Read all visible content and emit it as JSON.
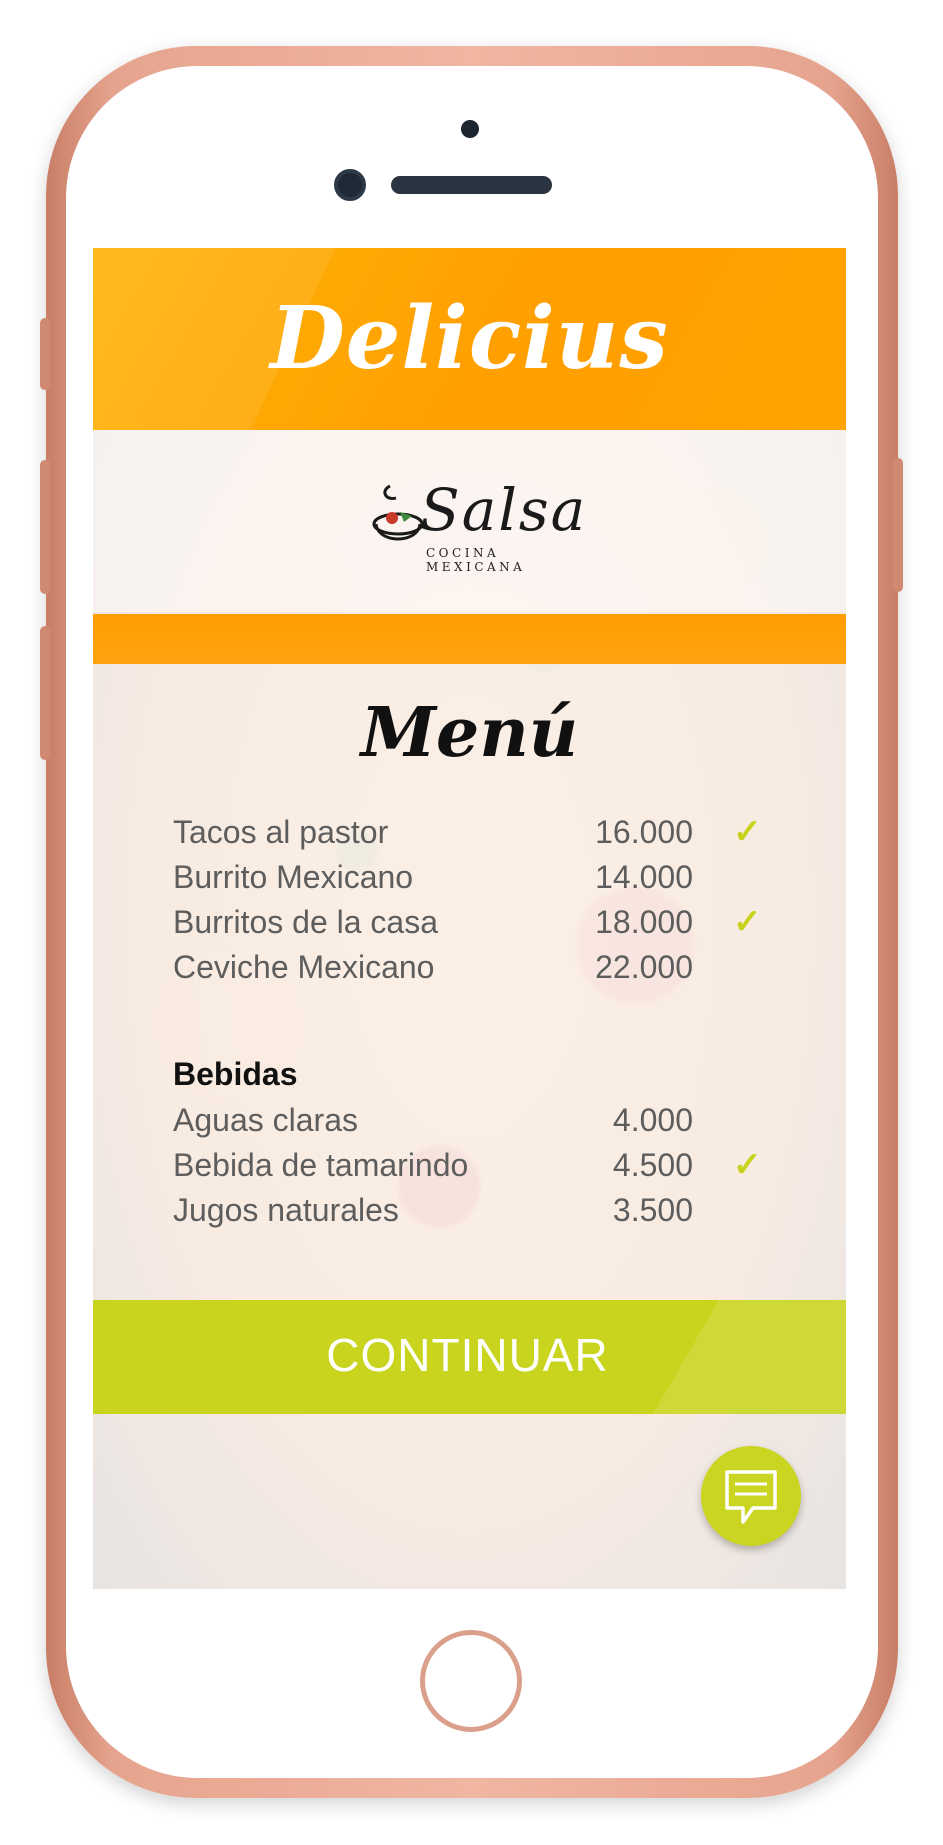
{
  "app": {
    "title": "Delicius"
  },
  "restaurant": {
    "logo_word": "Salsa",
    "logo_tagline": "COCINA MEXICANA"
  },
  "menu": {
    "title": "Menú",
    "items": [
      {
        "name": "Tacos al pastor",
        "price": "16.000",
        "selected": true
      },
      {
        "name": "Burrito Mexicano",
        "price": "14.000",
        "selected": false
      },
      {
        "name": "Burritos de la casa",
        "price": "18.000",
        "selected": true
      },
      {
        "name": "Ceviche Mexicano",
        "price": "22.000",
        "selected": false
      }
    ]
  },
  "drinks": {
    "title": "Bebidas",
    "items": [
      {
        "name": "Aguas claras",
        "price": "4.000",
        "selected": false
      },
      {
        "name": "Bebida de tamarindo",
        "price": "4.500",
        "selected": true
      },
      {
        "name": "Jugos naturales",
        "price": "3.500",
        "selected": false
      }
    ]
  },
  "actions": {
    "continue_label": "CONTINUAR",
    "chat_icon": "chat-bubble-icon"
  },
  "colors": {
    "header": "#ffa300",
    "accent": "#c8d41d",
    "check": "#c6d31c"
  }
}
